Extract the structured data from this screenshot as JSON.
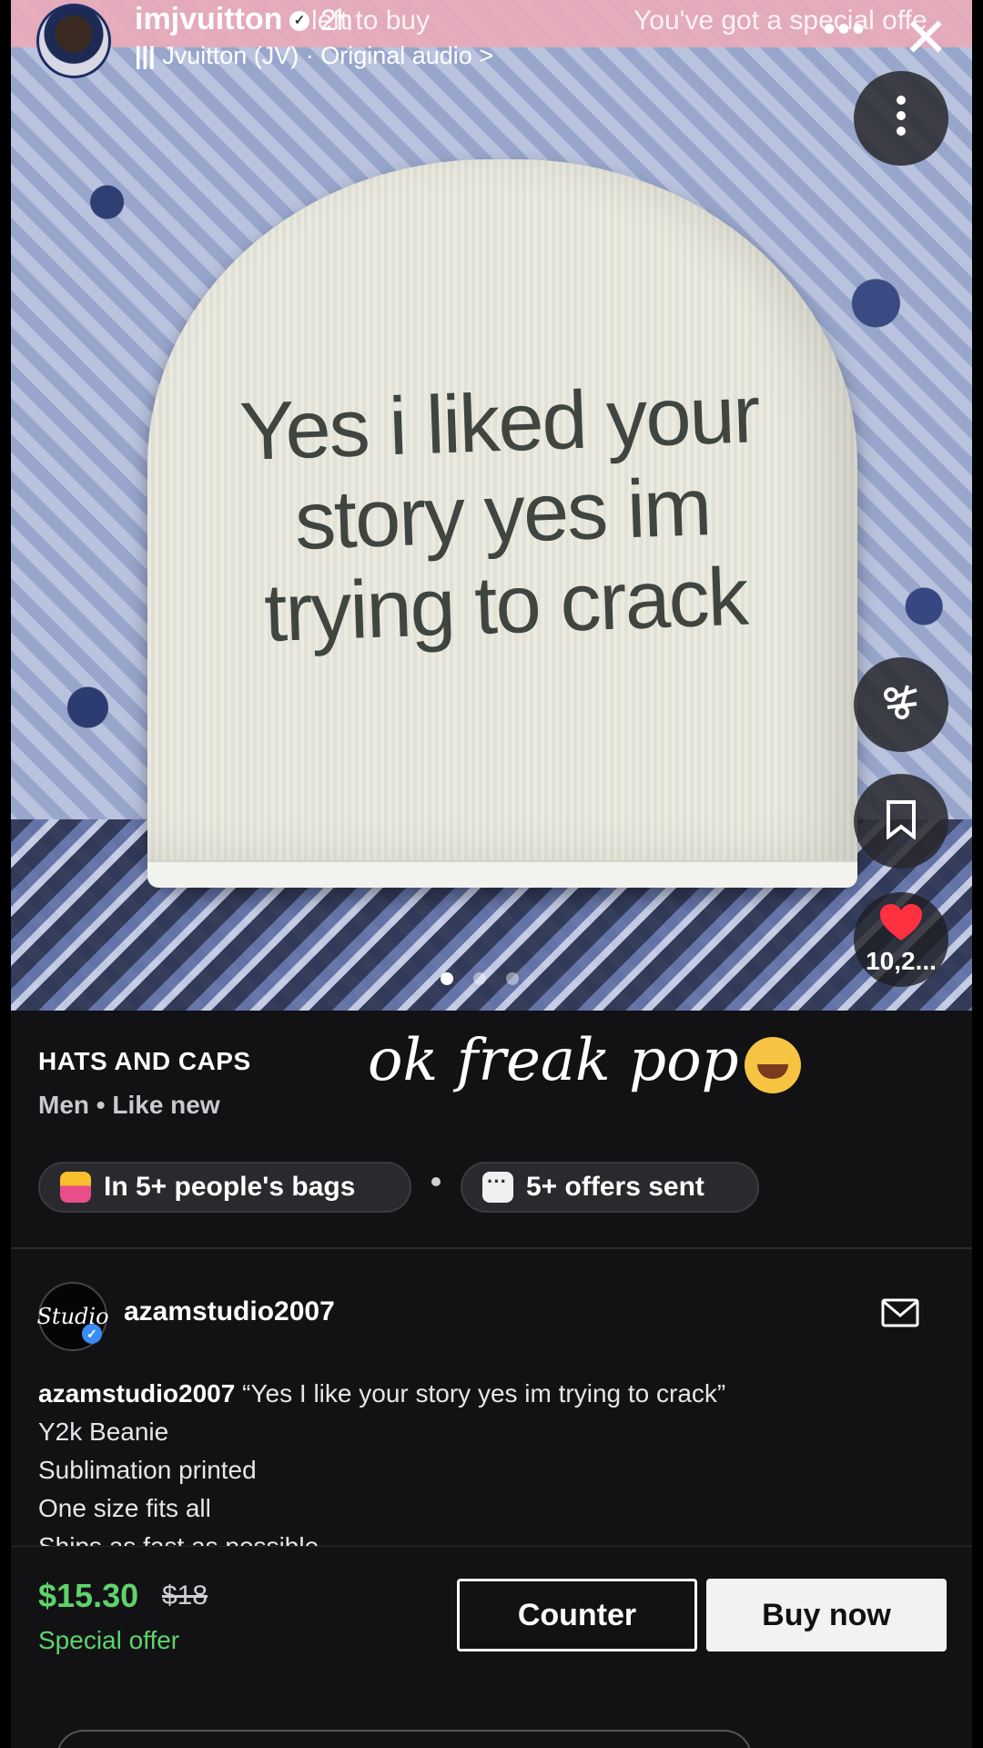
{
  "story": {
    "username": "imjvuitton",
    "time": "2h",
    "promo_left": "left to buy",
    "promo_right": "You've got a special offe",
    "audio": "Jvuitton (JV) · Original audio >",
    "more_icon": "ellipsis-horizontal-icon",
    "close_icon": "close-icon"
  },
  "photo": {
    "beanie_text": "Yes i liked your story yes im trying to crack",
    "pages": 3,
    "active_page": 0
  },
  "actions": {
    "more_icon": "kebab-vertical-icon",
    "share_icon": "share-icon",
    "save_icon": "bookmark-icon",
    "like_icon": "heart-icon",
    "like_count": "10,2..."
  },
  "product": {
    "category": "HATS AND CAPS",
    "condition": "Men • Like new",
    "caption": "ok freak pop"
  },
  "chips": {
    "bags": "In 5+ people's bags",
    "offers": "5+ offers sent"
  },
  "seller": {
    "avatar_text": "Studio",
    "name": "azamstudio2007"
  },
  "description": {
    "author": "azamstudio2007",
    "quote": "“Yes I like your story yes im trying to crack”",
    "lines": [
      "Y2k Beanie",
      "Sublimation printed",
      "One size fits all",
      "Ships as fast as possible"
    ]
  },
  "purchase": {
    "price": "$15.30",
    "old_price": "$18",
    "offer_label": "Special offer",
    "counter_label": "Counter",
    "buy_label": "Buy now"
  },
  "colors": {
    "accent_green": "#5fd36b",
    "background": "#121214",
    "like_red": "#ff3040"
  }
}
